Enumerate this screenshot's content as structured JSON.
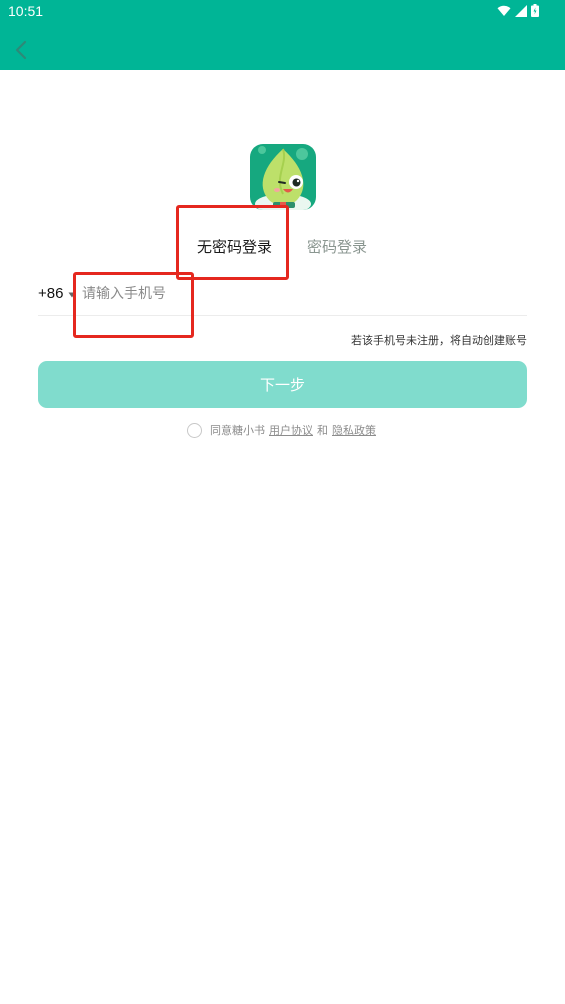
{
  "status_bar": {
    "time": "10:51",
    "icons": [
      "wifi-icon",
      "signal-icon",
      "battery-icon"
    ]
  },
  "header": {
    "back_icon": "chevron-left-icon",
    "color": "#00b596"
  },
  "logo": {
    "icon": "app-logo-leaf-mascot"
  },
  "login_tabs": {
    "passwordless": "无密码登录",
    "password": "密码登录",
    "active_color": "#1b1b1b",
    "inactive_color": "#8a9690"
  },
  "phone": {
    "country_code": "+86",
    "placeholder": "请输入手机号",
    "value": ""
  },
  "hint": "若该手机号未注册，将自动创建账号",
  "next_button": {
    "label": "下一步",
    "color": "#80dccd"
  },
  "agreement": {
    "prefix": "同意糖小书",
    "user_agreement": "用户协议",
    "conjunction": "和",
    "privacy_policy": "隐私政策"
  }
}
